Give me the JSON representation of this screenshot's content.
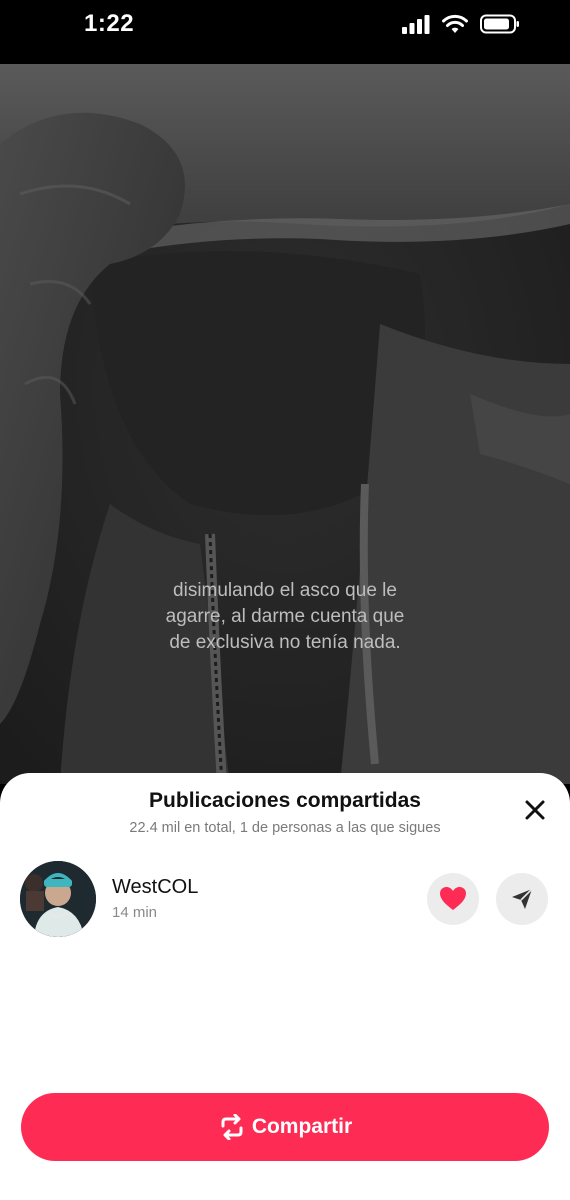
{
  "status_bar": {
    "time": "1:22"
  },
  "video": {
    "caption_lines": [
      "disimulando el asco que le",
      "agarre, al darme cuenta que",
      "de exclusiva no tenía nada."
    ]
  },
  "sheet": {
    "title": "Publicaciones compartidas",
    "subtitle": "22.4 mil en total, 1 de personas a las que sigues",
    "users": [
      {
        "name": "WestCOL",
        "time": "14 min"
      }
    ],
    "share_label": "Compartir"
  },
  "colors": {
    "accent": "#fe2c55",
    "heart": "#fe2c55",
    "sheet_bg": "#ffffff",
    "button_bg": "#ececec"
  },
  "icons": {
    "close": "close-icon",
    "like": "heart-icon",
    "send": "send-icon",
    "share": "repost-icon"
  }
}
